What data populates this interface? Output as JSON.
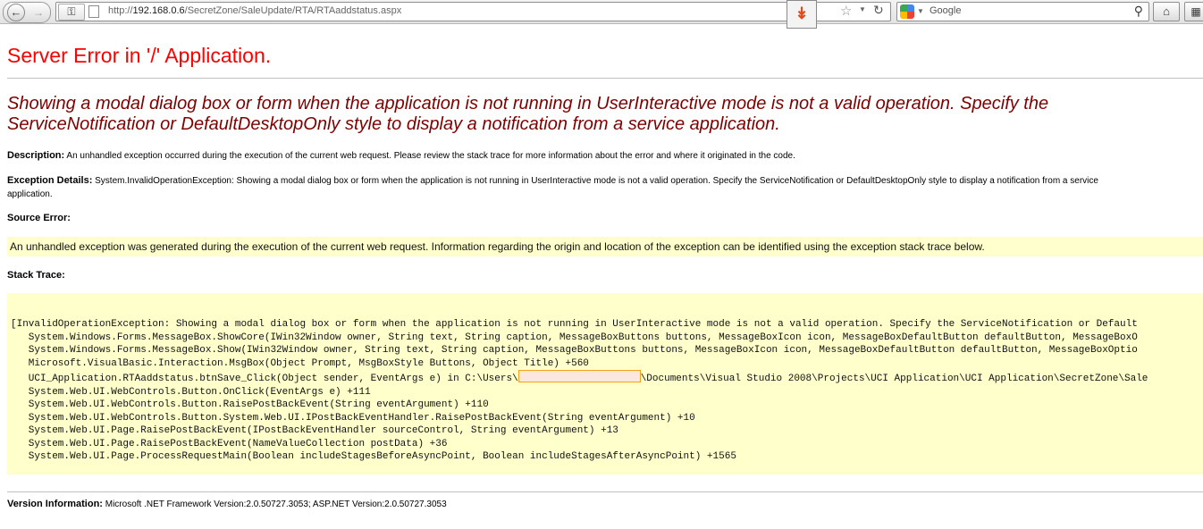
{
  "browser": {
    "url_prefix": "http://",
    "url_host": "192.168.0.6",
    "url_path": "/SecretZone/SaleUpdate/RTA/RTAaddstatus.aspx",
    "search_placeholder": "Google"
  },
  "page": {
    "title": "Server Error in '/' Application.",
    "message": "Showing a modal dialog box or form when the application is not running in UserInteractive mode is not a valid operation. Specify the ServiceNotification or DefaultDesktopOnly style to display a notification from a service application.",
    "description_label": "Description:",
    "description_text": "An unhandled exception occurred during the execution of the current web request. Please review the stack trace for more information about the error and where it originated in the code.",
    "exception_label": "Exception Details:",
    "exception_text": "System.InvalidOperationException: Showing a modal dialog box or form when the application is not running in UserInteractive mode is not a valid operation. Specify the ServiceNotification or DefaultDesktopOnly style to display a notification from a service",
    "exception_text_cont": "application.",
    "source_error_label": "Source Error:",
    "source_error_text": "An unhandled exception was generated during the execution of the current web request. Information regarding the origin and location of the exception can be identified using the exception stack trace below.",
    "stack_trace_label": "Stack Trace:",
    "stack_lines": [
      "[InvalidOperationException: Showing a modal dialog box or form when the application is not running in UserInteractive mode is not a valid operation. Specify the ServiceNotification or Default",
      "   System.Windows.Forms.MessageBox.ShowCore(IWin32Window owner, String text, String caption, MessageBoxButtons buttons, MessageBoxIcon icon, MessageBoxDefaultButton defaultButton, MessageBoxO",
      "   System.Windows.Forms.MessageBox.Show(IWin32Window owner, String text, String caption, MessageBoxButtons buttons, MessageBoxIcon icon, MessageBoxDefaultButton defaultButton, MessageBoxOptio",
      "   Microsoft.VisualBasic.Interaction.MsgBox(Object Prompt, MsgBoxStyle Buttons, Object Title) +560"
    ],
    "stack_redacted_before": "   UCI_Application.RTAaddstatus.btnSave_Click(Object sender, EventArgs e) in C:\\Users\\",
    "stack_redacted_after": "\\Documents\\Visual Studio 2008\\Projects\\UCI Application\\UCI Application\\SecretZone\\Sale",
    "stack_lines_after": [
      "   System.Web.UI.WebControls.Button.OnClick(EventArgs e) +111",
      "   System.Web.UI.WebControls.Button.RaisePostBackEvent(String eventArgument) +110",
      "   System.Web.UI.WebControls.Button.System.Web.UI.IPostBackEventHandler.RaisePostBackEvent(String eventArgument) +10",
      "   System.Web.UI.Page.RaisePostBackEvent(IPostBackEventHandler sourceControl, String eventArgument) +13",
      "   System.Web.UI.Page.RaisePostBackEvent(NameValueCollection postData) +36",
      "   System.Web.UI.Page.ProcessRequestMain(Boolean includeStagesBeforeAsyncPoint, Boolean includeStagesAfterAsyncPoint) +1565"
    ],
    "version_label": "Version Information:",
    "version_text": "Microsoft .NET Framework Version:2.0.50727.3053; ASP.NET Version:2.0.50727.3053"
  },
  "colors": {
    "title": "#ff0000",
    "message": "#800000",
    "highlight_box": "#ffffcc",
    "redaction_border": "#f3a21c"
  },
  "icons": {
    "back": "back-arrow-icon",
    "forward": "forward-arrow-icon",
    "site_identity": "key-icon",
    "page": "page-icon",
    "extension": "double-chevron-down-icon",
    "bookmark": "star-icon",
    "reload": "reload-icon",
    "search_engine": "google-icon",
    "search": "magnifier-icon",
    "home": "home-icon"
  }
}
